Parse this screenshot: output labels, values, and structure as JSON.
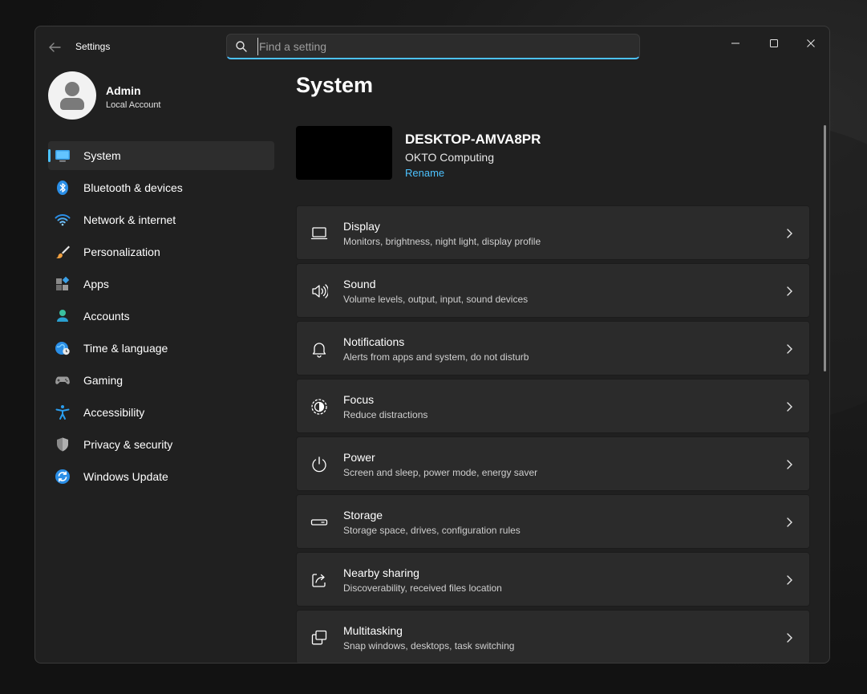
{
  "window": {
    "app_title": "Settings",
    "search_placeholder": "Find a setting"
  },
  "user": {
    "name": "Admin",
    "account_type": "Local Account"
  },
  "sidebar": {
    "items": [
      {
        "label": "System",
        "icon": "monitor-icon",
        "active": true
      },
      {
        "label": "Bluetooth & devices",
        "icon": "bluetooth-icon"
      },
      {
        "label": "Network & internet",
        "icon": "wifi-icon"
      },
      {
        "label": "Personalization",
        "icon": "brush-icon"
      },
      {
        "label": "Apps",
        "icon": "apps-icon"
      },
      {
        "label": "Accounts",
        "icon": "person-icon"
      },
      {
        "label": "Time & language",
        "icon": "globe-clock-icon"
      },
      {
        "label": "Gaming",
        "icon": "gamepad-icon"
      },
      {
        "label": "Accessibility",
        "icon": "accessibility-icon"
      },
      {
        "label": "Privacy & security",
        "icon": "shield-icon"
      },
      {
        "label": "Windows Update",
        "icon": "update-icon"
      }
    ]
  },
  "main": {
    "title": "System",
    "device": {
      "name": "DESKTOP-AMVA8PR",
      "manufacturer": "OKTO Computing",
      "rename_label": "Rename"
    },
    "cards": [
      {
        "title": "Display",
        "subtitle": "Monitors, brightness, night light, display profile",
        "icon": "display-icon"
      },
      {
        "title": "Sound",
        "subtitle": "Volume levels, output, input, sound devices",
        "icon": "speaker-icon"
      },
      {
        "title": "Notifications",
        "subtitle": "Alerts from apps and system, do not disturb",
        "icon": "bell-icon"
      },
      {
        "title": "Focus",
        "subtitle": "Reduce distractions",
        "icon": "focus-icon"
      },
      {
        "title": "Power",
        "subtitle": "Screen and sleep, power mode, energy saver",
        "icon": "power-icon"
      },
      {
        "title": "Storage",
        "subtitle": "Storage space, drives, configuration rules",
        "icon": "storage-icon"
      },
      {
        "title": "Nearby sharing",
        "subtitle": "Discoverability, received files location",
        "icon": "share-icon"
      },
      {
        "title": "Multitasking",
        "subtitle": "Snap windows, desktops, task switching",
        "icon": "multitasking-icon"
      }
    ]
  },
  "colors": {
    "accent": "#4cc2ff",
    "window_bg": "#202020",
    "card_bg": "#2b2b2b"
  }
}
